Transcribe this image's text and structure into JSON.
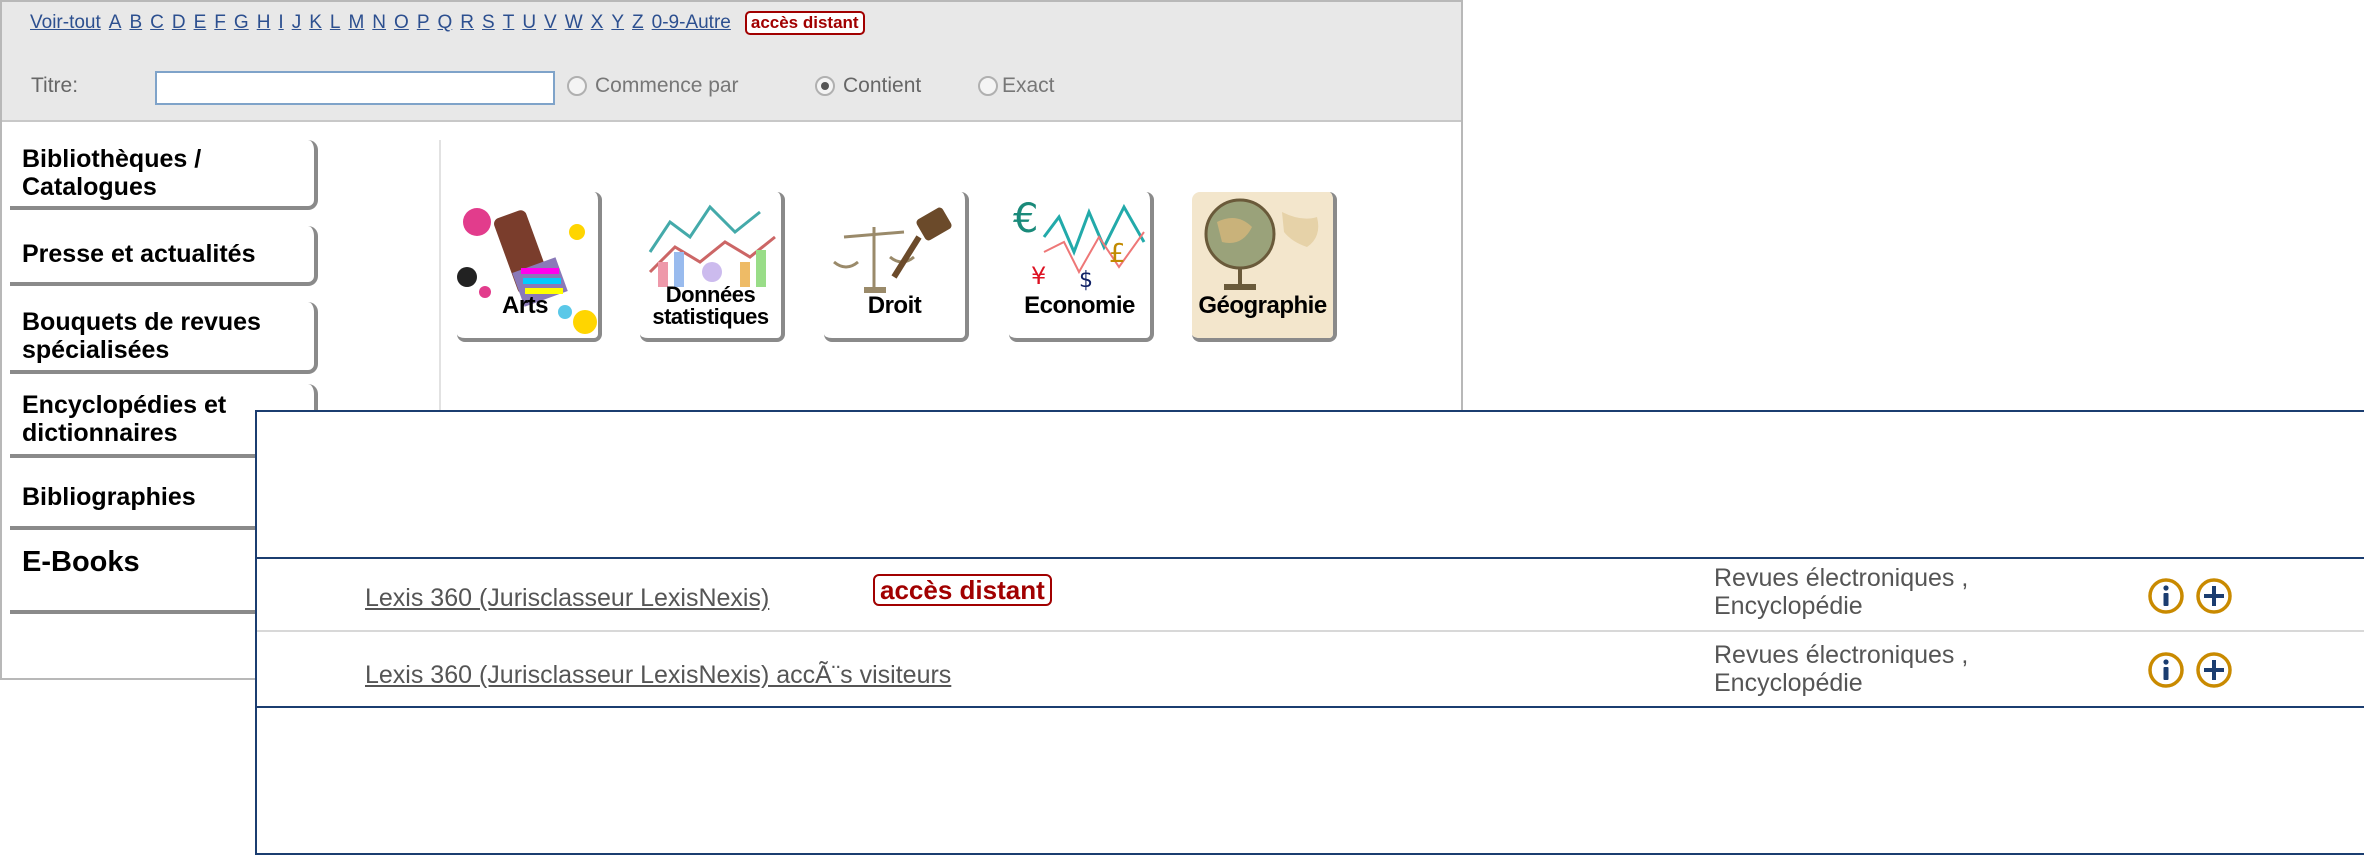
{
  "alphabet": {
    "all": "Voir-tout",
    "letters": [
      "A",
      "B",
      "C",
      "D",
      "E",
      "F",
      "G",
      "H",
      "I",
      "J",
      "K",
      "L",
      "M",
      "N",
      "O",
      "P",
      "Q",
      "R",
      "S",
      "T",
      "U",
      "V",
      "W",
      "X",
      "Y",
      "Z"
    ],
    "other": "0-9-Autre",
    "badge": "accès distant"
  },
  "search": {
    "label": "Titre:",
    "value": "",
    "options": [
      {
        "label": "Commence par",
        "selected": false
      },
      {
        "label": "Contient",
        "selected": true
      },
      {
        "label": "Exact",
        "selected": false
      }
    ]
  },
  "categories": [
    "Bibliothèques / Catalogues",
    "Presse et actualités",
    "Bouquets de revues spécialisées",
    "Encyclopédies et dictionnaires",
    "Bibliographies",
    "E-Books"
  ],
  "categories_line2": {
    "c0": "Catalogues",
    "c2": "spécialisées",
    "c3": "dictionnaires"
  },
  "categories_line1": {
    "c0": "Bibliothèques /",
    "c2": "Bouquets de revues",
    "c3": "Encyclopédies et"
  },
  "subjects": [
    {
      "label": "Arts",
      "icon": "paint-splash-icon"
    },
    {
      "label": "Données statistiques",
      "line1": "Données",
      "line2": "statistiques",
      "icon": "chart-collage-icon"
    },
    {
      "label": "Droit",
      "icon": "scales-gavel-icon"
    },
    {
      "label": "Economie",
      "icon": "currency-chart-icon"
    },
    {
      "label": "Géographie",
      "icon": "globe-icon"
    }
  ],
  "results": [
    {
      "title": "Lexis 360 (Jurisclasseur LexisNexis)",
      "badge": "accès distant",
      "type_line1": "Revues électroniques ,",
      "type_line2": "Encyclopédie"
    },
    {
      "title": "Lexis 360 (Jurisclasseur LexisNexis) accÃ¨s visiteurs",
      "type_line1": "Revues électroniques ,",
      "type_line2": "Encyclopédie"
    }
  ],
  "colors": {
    "badge": "#a10000",
    "dialog_border": "#1b3d70",
    "link": "#2c4f8f",
    "icon": "#c98a00"
  }
}
